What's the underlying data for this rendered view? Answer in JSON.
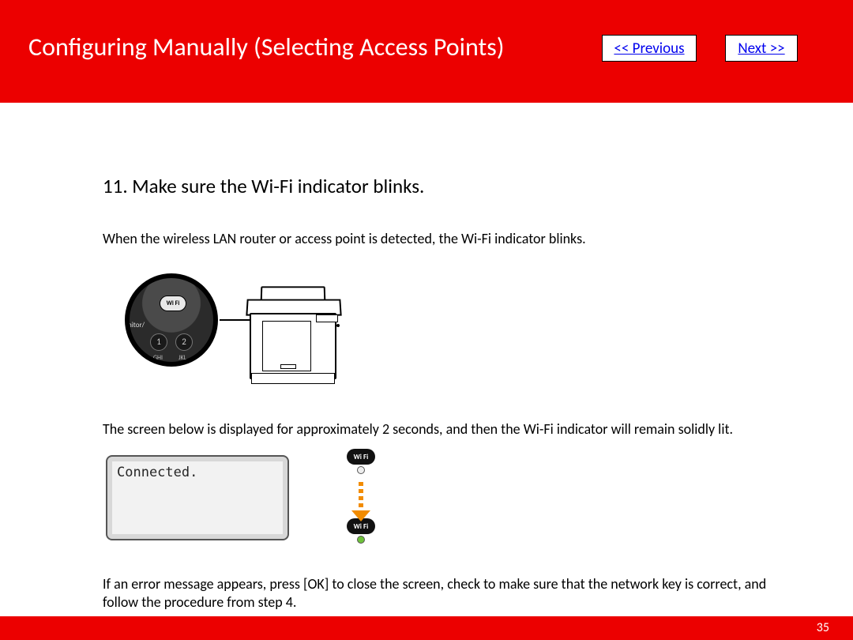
{
  "header": {
    "title": "Configuring Manually (Selecting Access Points)",
    "prev_label": "<< Previous",
    "next_label": "Next >>"
  },
  "step": {
    "heading": "11. Make sure the Wi-Fi indicator blinks.",
    "p1": "When the wireless LAN router or access point is detected, the Wi-Fi indicator blinks.",
    "p2": "The screen below is displayed for approximately 2 seconds, and then the Wi-Fi indicator will remain solidly lit.",
    "p3": "If an error message appears, press [OK] to close the screen, check to make sure that the network key is correct, and follow the procedure from step 4."
  },
  "figure1": {
    "wifi_label": "Wi Fi",
    "side_text": "nitor/",
    "key1": "1",
    "key2": "2",
    "lbl1": "GHI",
    "lbl2": "JKL"
  },
  "figure2": {
    "lcd_text": "Connected.",
    "badge_label": "Wi Fi"
  },
  "footer": {
    "page": "35"
  }
}
